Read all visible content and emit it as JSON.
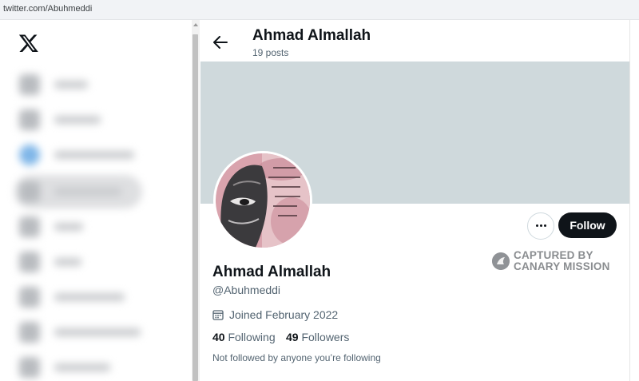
{
  "browser": {
    "url": "twitter.com/Abuhmeddi"
  },
  "header": {
    "name": "Ahmad Almallah",
    "posts": "19 posts"
  },
  "profile": {
    "name": "Ahmad Almallah",
    "handle": "@Abuhmeddi",
    "joined": "Joined February 2022",
    "following_count": "40",
    "following_label": "Following",
    "followers_count": "49",
    "followers_label": "Followers",
    "not_followed": "Not followed by anyone you’re following"
  },
  "actions": {
    "follow_label": "Follow",
    "more_icon": "more-horizontal-icon"
  },
  "watermark": {
    "line1": "CAPTURED BY",
    "line2": "CANARY MISSION"
  },
  "colors": {
    "banner": "#cfd9dc",
    "follow_bg": "#0f1419",
    "secondary_text": "#536471"
  }
}
